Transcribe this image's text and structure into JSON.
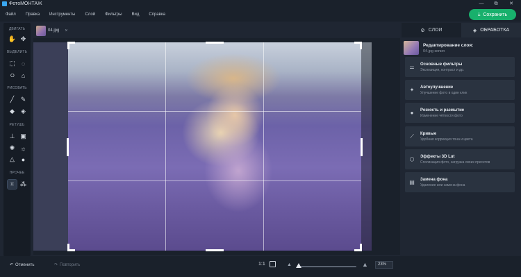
{
  "app": {
    "title": "ФотоМОНТАЖ",
    "window_controls": [
      "—",
      "⧉",
      "✕"
    ]
  },
  "menu": [
    "Файл",
    "Правка",
    "Инструменты",
    "Слой",
    "Фильтры",
    "Вид",
    "Справка"
  ],
  "save_button": {
    "label": "Сохранить",
    "icon": "download-icon"
  },
  "document_tab": {
    "name": "04.jpg",
    "close": "×"
  },
  "tools": {
    "sections": [
      {
        "title": "ДВИГАТЬ",
        "tools": [
          "hand-icon",
          "move-icon"
        ]
      },
      {
        "title": "ВЫДЕЛИТЬ",
        "tools": [
          "rect-select-icon",
          "ellipse-select-icon",
          "lasso-icon",
          "polygon-lasso-icon"
        ]
      },
      {
        "title": "РИСОВАТЬ",
        "tools": [
          "brush-icon",
          "pencil-icon",
          "eraser-icon",
          "fill-icon"
        ]
      },
      {
        "title": "РЕТУШЬ",
        "tools": [
          "stamp-icon",
          "patch-icon",
          "light-icon",
          "sun-icon",
          "triangle-icon",
          "drop-icon"
        ]
      },
      {
        "title": "ПРОЧЕЕ",
        "tools": [
          "crop-icon",
          "shapes-icon"
        ]
      }
    ],
    "active_tool": "crop-icon"
  },
  "bottom": {
    "undo_label": "Отменить",
    "redo_label": "Повторить",
    "zoom_actual": "1:1",
    "zoom_value": "23%",
    "zoom_fraction": 0.02
  },
  "right_panel": {
    "tabs": [
      {
        "label": "СЛОИ",
        "icon": "layers-settings-icon"
      },
      {
        "label": "ОБРАБОТКА",
        "icon": "layers-icon"
      }
    ],
    "active_tab": "ОБРАБОТКА",
    "layer": {
      "title": "Редактирование слоя:",
      "subtitle": "04.jpg копия"
    },
    "filters": [
      {
        "title": "Основные фильтры",
        "subtitle": "Экспозиция, контраст и др.",
        "icon": "sliders-icon"
      },
      {
        "title": "Автоулучшение",
        "subtitle": "Улучшение фото в один клик",
        "icon": "magic-wand-icon"
      },
      {
        "title": "Резкость и размытие",
        "subtitle": "Изменение чёткости фото",
        "icon": "drop-icon"
      },
      {
        "title": "Кривые",
        "subtitle": "Удобная коррекция тона и цвета",
        "icon": "curves-icon"
      },
      {
        "title": "Эффекты 3D Lut",
        "subtitle": "Стилизация фото, загрузка своих пресетов",
        "icon": "cube-icon"
      },
      {
        "title": "Замена фона",
        "subtitle": "Удаление или замена фона",
        "icon": "background-icon"
      }
    ]
  },
  "colors": {
    "accent": "#18b06c",
    "panel": "#2a3340",
    "background": "#1f2632"
  }
}
